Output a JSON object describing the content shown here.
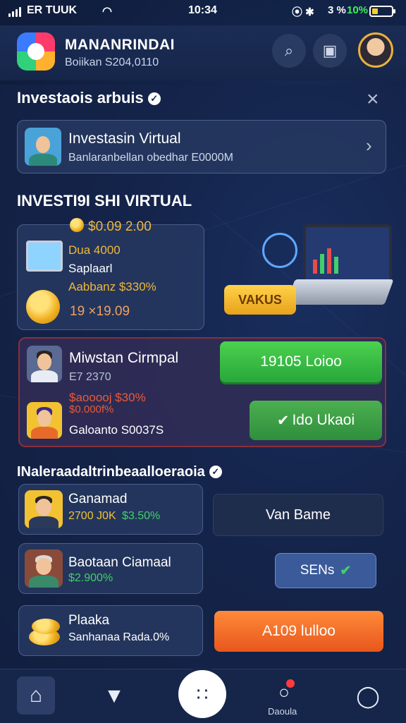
{
  "status_bar": {
    "carrier": "ER TUUK",
    "time": "10:34",
    "battery_text": "3 %",
    "battery_level": "10%"
  },
  "header": {
    "app_name": "MANANRINDAI",
    "balance": "Boiikan S204,0110"
  },
  "sheet": {
    "title": "Investaois arbuis",
    "close_label": "×",
    "feature_card": {
      "title": "Investasin Virtual",
      "subtitle": "Banlaranbellan obedhar E0000M"
    }
  },
  "virtual_section": {
    "title": "INVESTI9I SHI VIRTUAL",
    "summary": {
      "top_value": "$0.09 2.00",
      "line1": "Dua 4000",
      "line2": "Saplaarl",
      "line3": "Aabbanz $330%",
      "amount": "19 ×19.09"
    },
    "promo_badge": "VAKUS"
  },
  "offer": {
    "name": "Miwstan Cirmpal",
    "code": "E7 2370",
    "stat1": "$aooooj $30%",
    "stat2": "$0.000f%",
    "stat3": "Galoanto S0037S",
    "primary_button": "19105 Loioo",
    "secondary_button": "Ido Ukaoi"
  },
  "list_section": {
    "title": "INaleraadaltrinbeaalloeraoia",
    "items": [
      {
        "name": "Ganamad",
        "sub_left": "2700 J0K",
        "sub_right": "$3.50%",
        "action": "Van Bame"
      },
      {
        "name": "Baotaan Ciamaal",
        "sub_left": "$2.900%",
        "sub_right": "",
        "action": "SENs"
      },
      {
        "name": "Plaaka",
        "sub_left": "Sanhanaa Rada.0%",
        "sub_right": "",
        "action": "A109 lulloo"
      }
    ]
  },
  "nav": {
    "alerts_label": "Daoula"
  },
  "colors": {
    "accent_green": "#41d06a",
    "accent_gold": "#f2c232",
    "accent_orange": "#ff8a3a",
    "background": "#13244a"
  }
}
